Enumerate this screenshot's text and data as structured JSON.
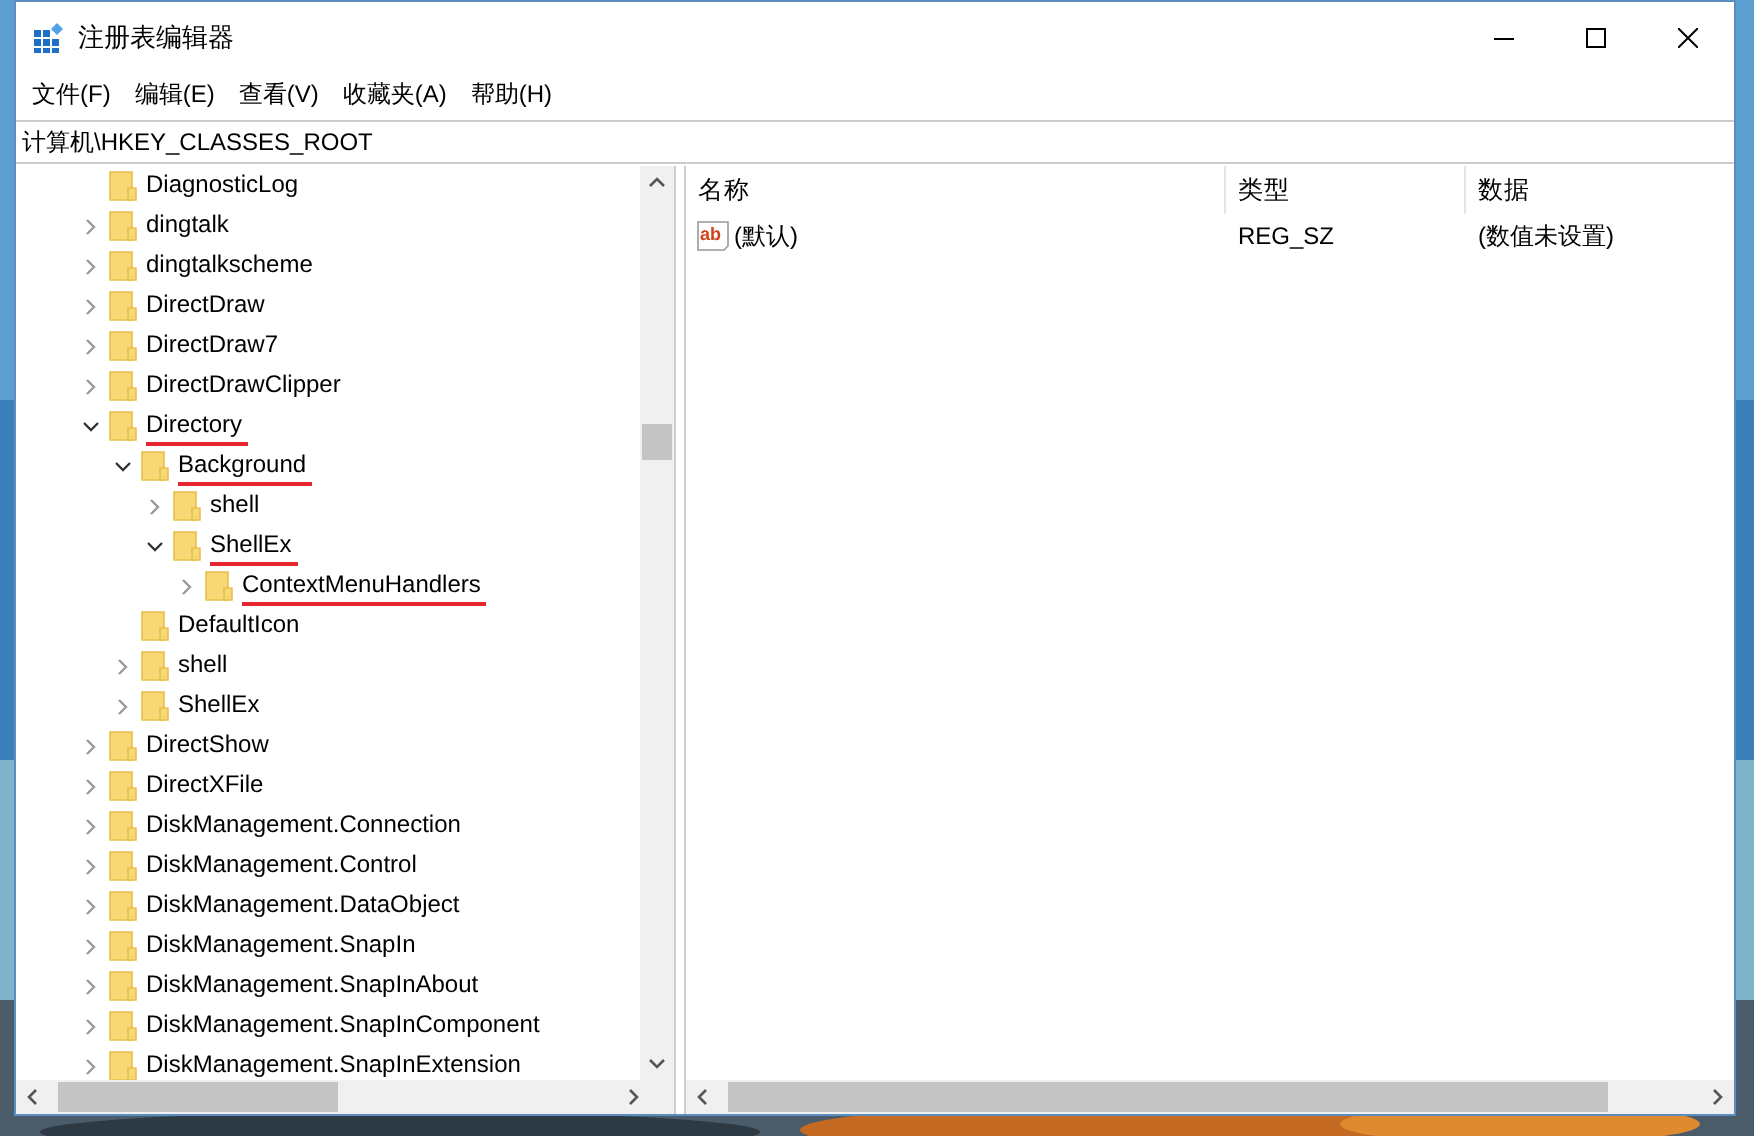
{
  "window": {
    "title": "注册表编辑器"
  },
  "menu": [
    "文件(F)",
    "编辑(E)",
    "查看(V)",
    "收藏夹(A)",
    "帮助(H)"
  ],
  "address": "计算机\\HKEY_CLASSES_ROOT",
  "tree": [
    {
      "label": "DiagnosticLog",
      "expandable": false,
      "highlighted": false
    },
    {
      "label": "dingtalk",
      "expandable": true,
      "expanded": false,
      "highlighted": false
    },
    {
      "label": "dingtalkscheme",
      "expandable": true,
      "expanded": false,
      "highlighted": false
    },
    {
      "label": "DirectDraw",
      "expandable": true,
      "expanded": false,
      "highlighted": false
    },
    {
      "label": "DirectDraw7",
      "expandable": true,
      "expanded": false,
      "highlighted": false
    },
    {
      "label": "DirectDrawClipper",
      "expandable": true,
      "expanded": false,
      "highlighted": false
    },
    {
      "label": "Directory",
      "expandable": true,
      "expanded": true,
      "highlighted": true,
      "children": [
        {
          "label": "Background",
          "expandable": true,
          "expanded": true,
          "highlighted": true,
          "children": [
            {
              "label": "shell",
              "expandable": true,
              "expanded": false,
              "highlighted": false
            },
            {
              "label": "ShellEx",
              "expandable": true,
              "expanded": true,
              "highlighted": true,
              "children": [
                {
                  "label": "ContextMenuHandlers",
                  "expandable": true,
                  "expanded": false,
                  "highlighted": true
                }
              ]
            }
          ]
        },
        {
          "label": "DefaultIcon",
          "expandable": false,
          "highlighted": false
        },
        {
          "label": "shell",
          "expandable": true,
          "expanded": false,
          "highlighted": false
        },
        {
          "label": "ShellEx",
          "expandable": true,
          "expanded": false,
          "highlighted": false
        }
      ]
    },
    {
      "label": "DirectShow",
      "expandable": true,
      "expanded": false,
      "highlighted": false
    },
    {
      "label": "DirectXFile",
      "expandable": true,
      "expanded": false,
      "highlighted": false
    },
    {
      "label": "DiskManagement.Connection",
      "expandable": true,
      "expanded": false,
      "highlighted": false
    },
    {
      "label": "DiskManagement.Control",
      "expandable": true,
      "expanded": false,
      "highlighted": false
    },
    {
      "label": "DiskManagement.DataObject",
      "expandable": true,
      "expanded": false,
      "highlighted": false
    },
    {
      "label": "DiskManagement.SnapIn",
      "expandable": true,
      "expanded": false,
      "highlighted": false
    },
    {
      "label": "DiskManagement.SnapInAbout",
      "expandable": true,
      "expanded": false,
      "highlighted": false
    },
    {
      "label": "DiskManagement.SnapInComponent",
      "expandable": true,
      "expanded": false,
      "highlighted": false
    },
    {
      "label": "DiskManagement.SnapInExtension",
      "expandable": true,
      "expanded": false,
      "highlighted": false
    }
  ],
  "values_table": {
    "columns": [
      "名称",
      "类型",
      "数据"
    ],
    "rows": [
      {
        "icon": "ab",
        "name": "(默认)",
        "type": "REG_SZ",
        "data": "(数值未设置)"
      }
    ]
  }
}
